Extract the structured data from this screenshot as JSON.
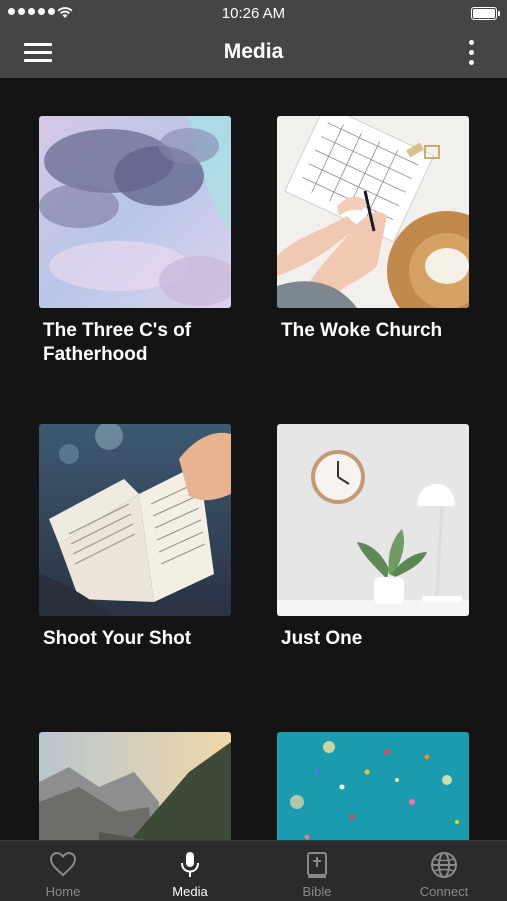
{
  "status_bar": {
    "time": "10:26 AM"
  },
  "nav": {
    "title": "Media"
  },
  "media_items": [
    {
      "title": "The Three C's of Fatherhood",
      "image": "pastel-clouds-image"
    },
    {
      "title": "The Woke Church",
      "image": "planner-writing-image"
    },
    {
      "title": "Shoot Your Shot",
      "image": "open-bible-image"
    },
    {
      "title": "Just One",
      "image": "clock-plant-lamp-image"
    },
    {
      "title": "",
      "image": "mountain-landscape-image"
    },
    {
      "title": "",
      "image": "teal-confetti-image"
    }
  ],
  "tabs": [
    {
      "label": "Home",
      "icon": "heart-icon",
      "active": false
    },
    {
      "label": "Media",
      "icon": "microphone-icon",
      "active": true
    },
    {
      "label": "Bible",
      "icon": "bible-icon",
      "active": false
    },
    {
      "label": "Connect",
      "icon": "globe-icon",
      "active": false
    }
  ],
  "colors": {
    "bar": "#454545",
    "background": "#141414",
    "tabbar": "#2b2b2b",
    "tab_inactive": "#8a8a8a",
    "tab_active": "#ffffff"
  }
}
